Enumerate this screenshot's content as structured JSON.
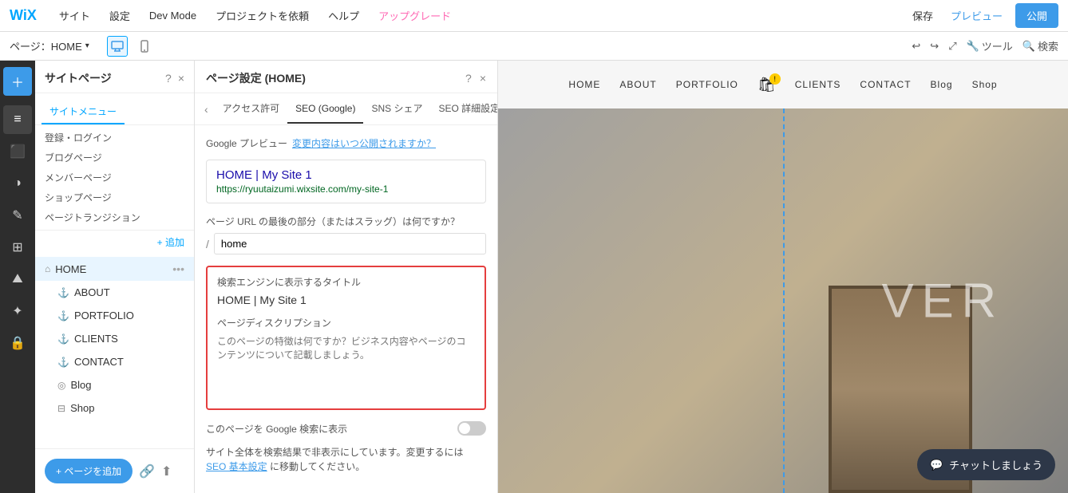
{
  "topbar": {
    "logo": "WiX",
    "menus": [
      "サイト",
      "設定",
      "Dev Mode",
      "プロジェクトを依頼",
      "ヘルプ"
    ],
    "upgrade": "アップグレード",
    "save": "保存",
    "preview": "プレビュー",
    "publish": "公開"
  },
  "secondbar": {
    "page_label": "ページ：HOME",
    "undo": "↩",
    "redo": "↪",
    "tools": "ツール",
    "search": "検索"
  },
  "site_pages": {
    "title": "サイトページ",
    "help": "?",
    "close": "×",
    "tabs": [
      "サイトメニュー",
      "登録・ログイン",
      "ブログページ",
      "メンバーページ",
      "ショップページ",
      "ページトランジション"
    ],
    "active_tab": "サイトメニュー",
    "add_label": "+ 追加",
    "pages": [
      {
        "label": "HOME",
        "icon": "⌂",
        "active": true
      },
      {
        "label": "ABOUT",
        "icon": "⚓",
        "sub": true
      },
      {
        "label": "PORTFOLIO",
        "icon": "⚓",
        "sub": true
      },
      {
        "label": "CLIENTS",
        "icon": "⚓",
        "sub": true
      },
      {
        "label": "CONTACT",
        "icon": "⚓",
        "sub": true
      },
      {
        "label": "Blog",
        "icon": "◎",
        "sub": true
      },
      {
        "label": "Shop",
        "icon": "⊟",
        "sub": true
      }
    ],
    "add_page_btn": "+ ページを追加"
  },
  "page_settings": {
    "title": "ページ設定 (HOME)",
    "help": "?",
    "close": "×",
    "back": "‹",
    "tabs": [
      "アクセス許可",
      "SEO (Google)",
      "SNS シェア",
      "SEO 詳細設定"
    ],
    "active_tab": "SEO (Google)",
    "google_preview_text": "Google プレビュー",
    "google_preview_link": "変更内容はいつ公開されますか？",
    "preview_title": "HOME | My Site 1",
    "preview_url": "https://ryuutaizumi.wixsite.com/my-site-1",
    "url_label": "ページ URL の最後の部分（またはスラッグ）は何ですか？",
    "url_slash": "/",
    "url_value": "home",
    "seo_title_label": "検索エンジンに表示するタイトル",
    "seo_title_value": "HOME | My Site 1",
    "seo_desc_label": "ページディスクリプション",
    "seo_desc_placeholder": "このページの特徴は何ですか？ビジネス内容やページのコンテンツについて記載しましょう。",
    "google_show_label": "このページを Google 検索に表示",
    "note_text": "サイト全体を検索結果で非表示にしています。変更するには",
    "note_link": "SEO 基本設定",
    "note_text2": "に移動してください。"
  },
  "preview_nav": {
    "links": [
      "HOME",
      "ABOUT",
      "PORTFOLIO",
      "CLIENTS",
      "CONTACT",
      "Blog",
      "Shop"
    ]
  },
  "chat": {
    "label": "チャットしましょう"
  }
}
